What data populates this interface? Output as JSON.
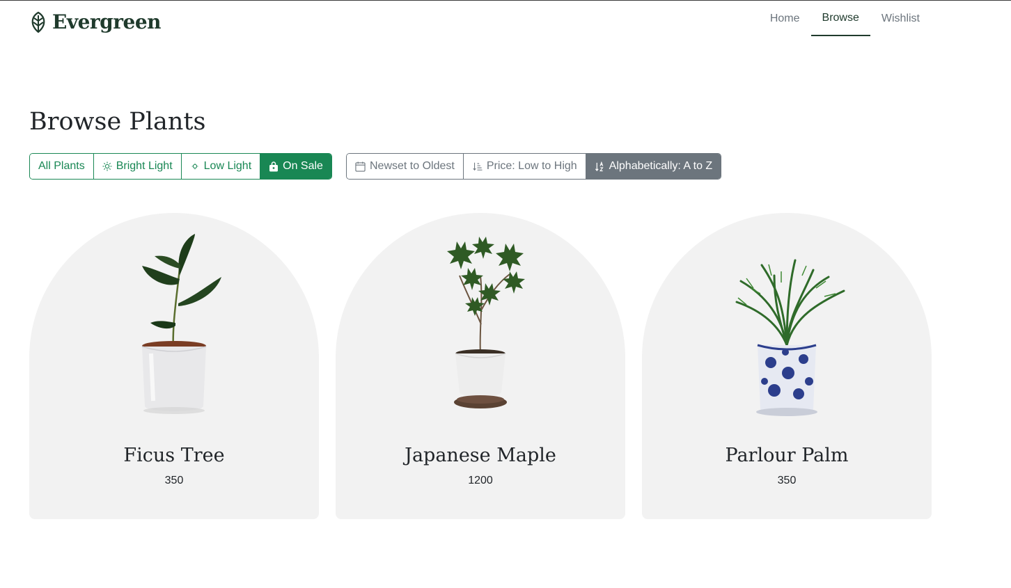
{
  "brand": {
    "name": "Evergreen",
    "icon": "leaf-logo-icon"
  },
  "nav": [
    {
      "label": "Home",
      "active": false
    },
    {
      "label": "Browse",
      "active": true
    },
    {
      "label": "Wishlist",
      "active": false
    }
  ],
  "page": {
    "title": "Browse Plants"
  },
  "filters": [
    {
      "label": "All Plants",
      "icon": "",
      "active": false
    },
    {
      "label": "Bright Light",
      "icon": "sun-icon",
      "active": false
    },
    {
      "label": "Low Light",
      "icon": "dim-sun-icon",
      "active": false
    },
    {
      "label": "On Sale",
      "icon": "bag-icon",
      "active": true
    }
  ],
  "sorts": [
    {
      "label": "Newset to Oldest",
      "icon": "calendar-icon",
      "active": false
    },
    {
      "label": "Price: Low to High",
      "icon": "sort-ascending-icon",
      "active": false
    },
    {
      "label": "Alphabetically: A to Z",
      "icon": "sort-alpha-icon",
      "active": true
    }
  ],
  "products": [
    {
      "name": "Ficus Tree",
      "price": "350"
    },
    {
      "name": "Japanese Maple",
      "price": "1200"
    },
    {
      "name": "Parlour Palm",
      "price": "350"
    }
  ],
  "colors": {
    "brand": "#1f3a2c",
    "success": "#198754",
    "secondary": "#6c757d",
    "card_bg": "#f2f2f2"
  }
}
